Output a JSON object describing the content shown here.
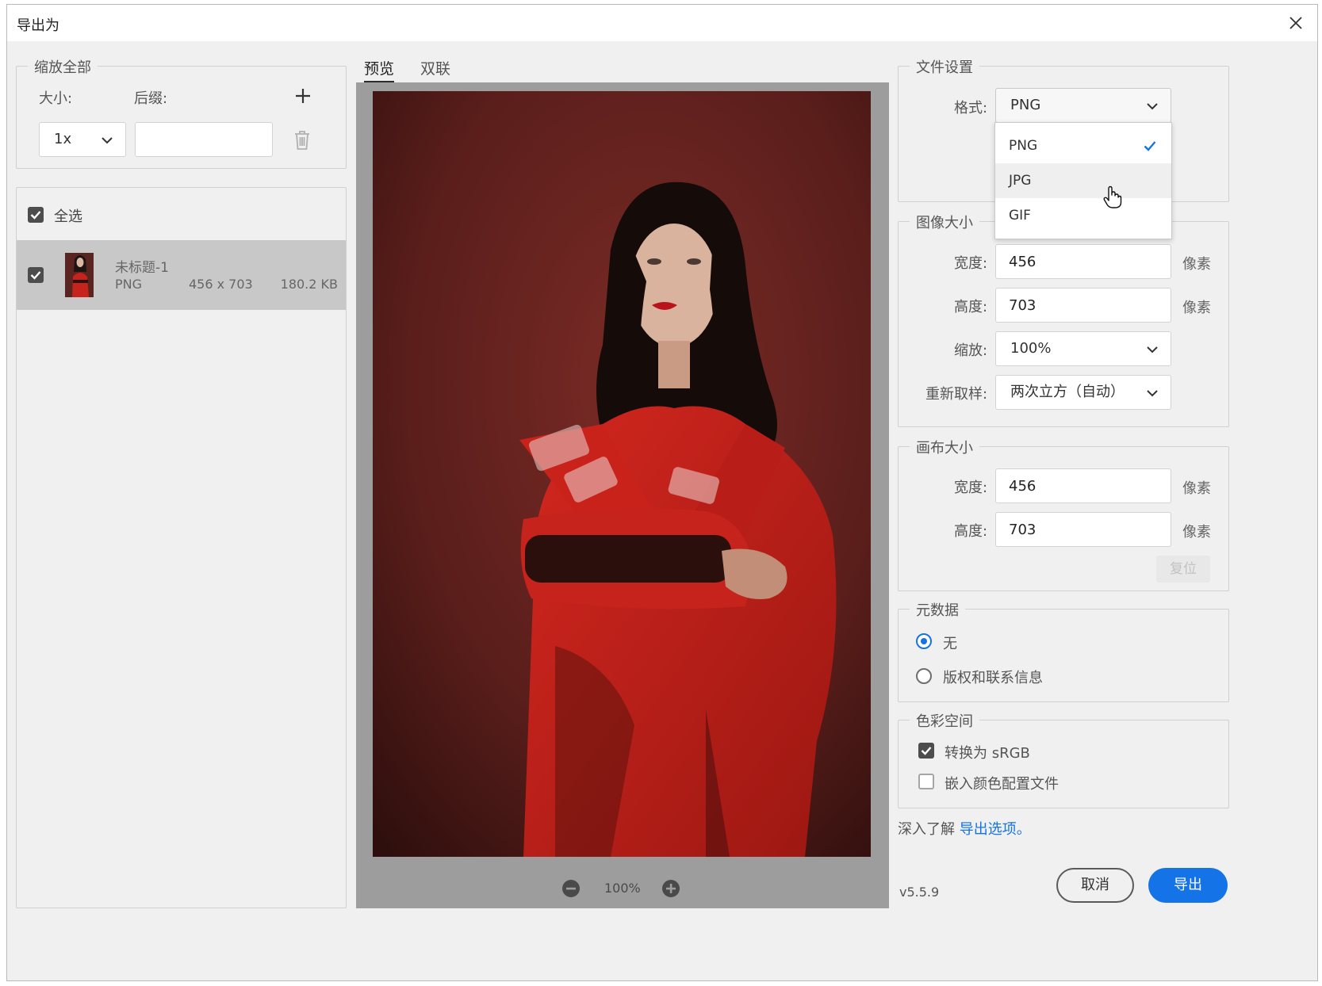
{
  "window": {
    "title": "导出为"
  },
  "scale_all": {
    "legend": "缩放全部",
    "size_label": "大小:",
    "suffix_label": "后缀:",
    "size_value": "1x",
    "suffix_value": ""
  },
  "assets": {
    "select_all_label": "全选",
    "select_all_checked": true,
    "items": [
      {
        "name": "未标题-1",
        "format": "PNG",
        "dimensions": "456 x 703",
        "size": "180.2 KB",
        "checked": true
      }
    ]
  },
  "tabs": [
    {
      "label": "预览",
      "active": true
    },
    {
      "label": "双联",
      "active": false
    }
  ],
  "preview": {
    "zoom": "100%"
  },
  "file_settings": {
    "legend": "文件设置",
    "format_label": "格式:",
    "format_value": "PNG",
    "format_options": [
      {
        "label": "PNG",
        "selected": true
      },
      {
        "label": "JPG",
        "selected": false,
        "hovered": true
      },
      {
        "label": "GIF",
        "selected": false
      }
    ]
  },
  "image_size": {
    "legend": "图像大小",
    "width_label": "宽度:",
    "width_value": "456",
    "height_label": "高度:",
    "height_value": "703",
    "unit": "像素",
    "scale_label": "缩放:",
    "scale_value": "100%",
    "resample_label": "重新取样:",
    "resample_value": "两次立方（自动）"
  },
  "canvas_size": {
    "legend": "画布大小",
    "width_label": "宽度:",
    "width_value": "456",
    "height_label": "高度:",
    "height_value": "703",
    "unit": "像素",
    "reset_label": "复位"
  },
  "metadata": {
    "legend": "元数据",
    "options": [
      {
        "label": "无",
        "selected": true
      },
      {
        "label": "版权和联系信息",
        "selected": false
      }
    ]
  },
  "color_space": {
    "legend": "色彩空间",
    "convert_label": "转换为 sRGB",
    "convert_checked": true,
    "embed_label": "嵌入颜色配置文件",
    "embed_checked": false
  },
  "learn_more": {
    "prefix": "深入了解",
    "link": "导出选项。"
  },
  "footer": {
    "version": "v5.5.9",
    "cancel": "取消",
    "export": "导出"
  },
  "colors": {
    "accent": "#1473e6",
    "dialog_bg": "#f0f0f0",
    "preview_bg": "#9d9d9d"
  }
}
